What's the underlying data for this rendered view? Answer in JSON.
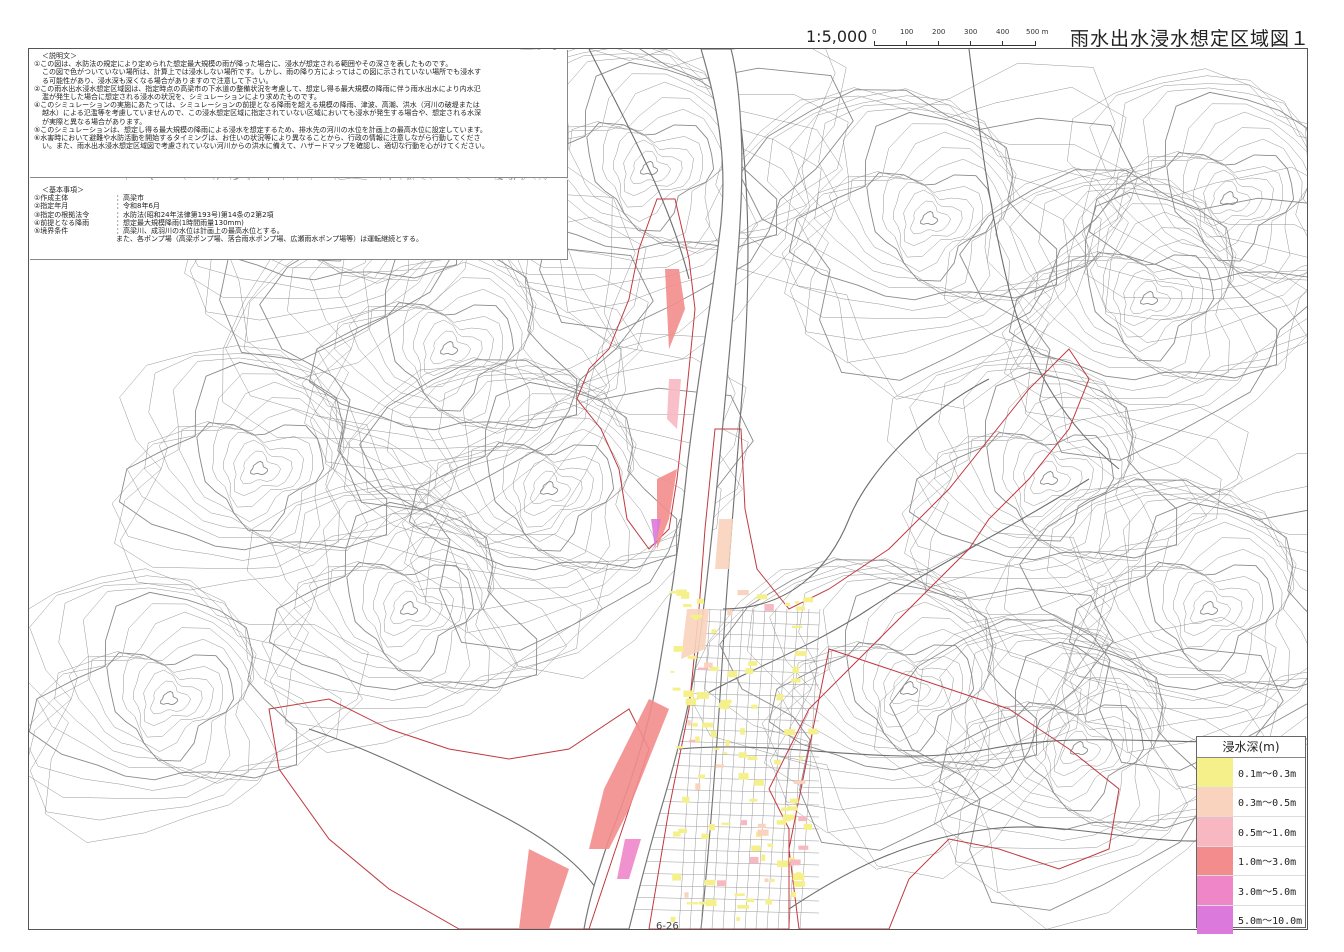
{
  "header": {
    "title": "雨水出水浸水想定区域図１",
    "scale": "1:5,000",
    "scalebar": {
      "ticks": [
        "0",
        "100",
        "200",
        "300",
        "400",
        "500 m"
      ]
    }
  },
  "description": {
    "heading": "＜説明文＞",
    "lines": [
      "①この図は、水防法の規定により定められた想定最大規模の雨が降った場合に、浸水が想定される範囲やその深さを表したものです。",
      "この図で色がついていない場所は、計算上では浸水しない場所です。しかし、雨の降り方によってはこの図に示されていない場所でも浸水す",
      "る可能性があり、浸水深も深くなる場合がありますので注意して下さい。",
      "②この雨水出水浸水想定区域図は、指定時点の高梁市の下水道の整備状況を考慮して、想定し得る最大規模の降雨に伴う雨水出水により内水氾",
      "濫が発生した場合に想定される浸水の状況を、シミュレーションにより求めたものです。",
      "④このシミュレーションの実施にあたっては、シミュレーションの前提となる降雨を超える規模の降雨、津波、高潮、洪水（河川の破堤または",
      "越水）による氾濫等を考慮していませんので、この浸水想定区域に指定されていない区域においても浸水が発生する場合や、想定される水深",
      "が実際と異なる場合があります。",
      "⑤このシミュレーションは、想定し得る最大規模の降雨による浸水を想定するため、排水先の河川の水位を計画上の最高水位に設定しています。",
      "⑥水害時において避難や水防活動を開始するタイミングは、お住いの状況等により異なることから、行政の情報に注意しながら行動してくださ",
      "い。また、雨水出水浸水想定区域図で考慮されていない河川からの洪水に備えて、ハザードマップを確認し、適切な行動を心がけてください。"
    ]
  },
  "basic": {
    "heading": "＜基本事項＞",
    "items": [
      {
        "k": "①作成主体",
        "v": "：高梁市"
      },
      {
        "k": "②指定年月",
        "v": "：令和8年6月"
      },
      {
        "k": "③指定の根拠法令",
        "v": "：水防法(昭和24年法律第193号)第14条の2第2項"
      },
      {
        "k": "④前提となる降雨",
        "v": "：想定最大規模降雨(1時間雨量130mm)"
      },
      {
        "k": "⑤境界条件",
        "v": "：高梁川、成羽川の水位は計画上の最高水位とする。"
      }
    ],
    "continuation": "また、各ポンプ場（高梁ポンプ場、落合雨水ポンプ場、広瀬雨水ポンプ場等）は運転継続とする。"
  },
  "legend": {
    "title": "浸水深(m)",
    "items": [
      {
        "label": "0.1m～0.3m",
        "color": "#f5f08a"
      },
      {
        "label": "0.3m～0.5m",
        "color": "#f9d3bd"
      },
      {
        "label": "0.5m～1.0m",
        "color": "#f8b8c2"
      },
      {
        "label": "1.0m～3.0m",
        "color": "#f38c8c"
      },
      {
        "label": "3.0m～5.0m",
        "color": "#ee86c8"
      },
      {
        "label": "5.0m～10.0m",
        "color": "#dc79dc"
      }
    ]
  },
  "map_colors": {
    "contour": "#8a8a8a",
    "road": "#6e6e6e",
    "boundary": "#c0393f",
    "river": "#ffffff"
  },
  "footer": {
    "page": "6-26"
  }
}
